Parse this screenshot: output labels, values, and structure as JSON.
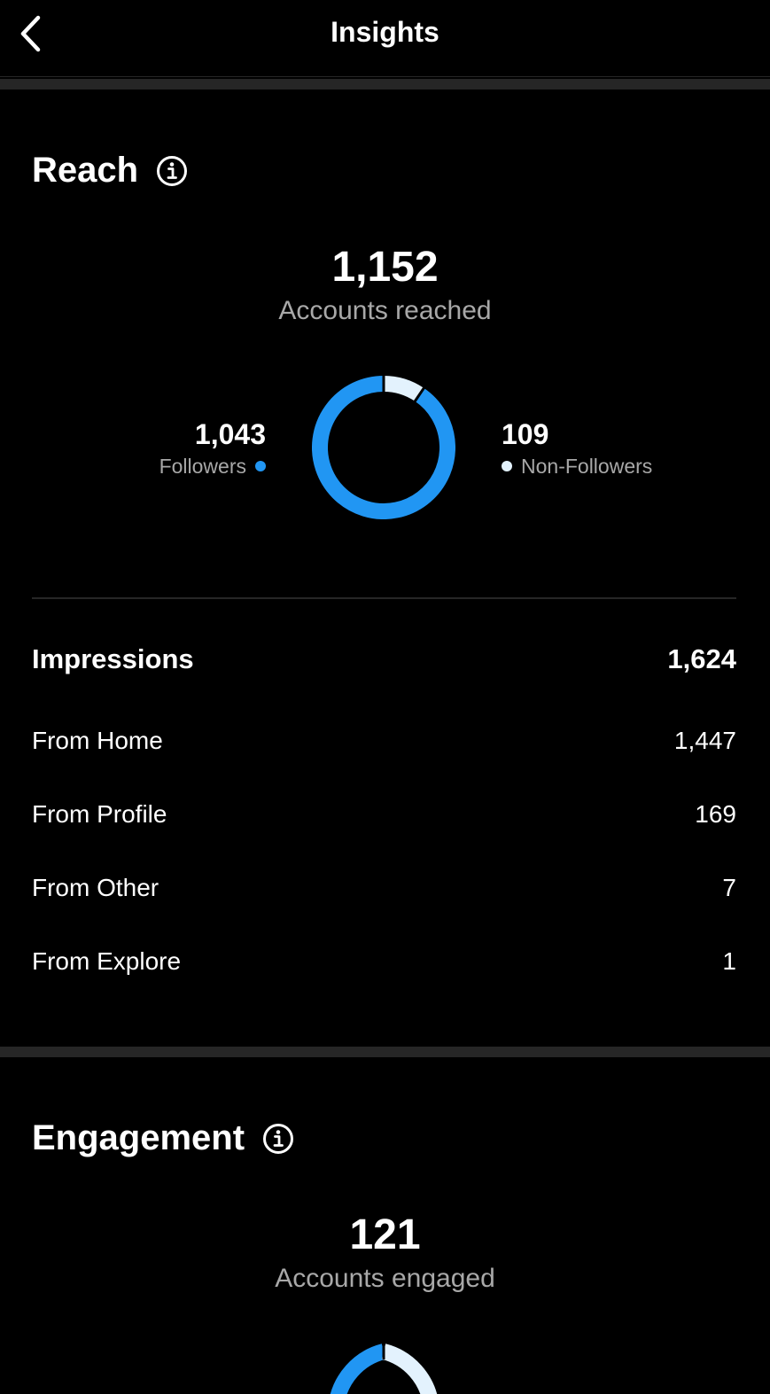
{
  "header": {
    "title": "Insights"
  },
  "reach": {
    "title": "Reach",
    "accounts_reached": "1,152",
    "accounts_reached_label": "Accounts reached",
    "followers_value": "1,043",
    "followers_label": "Followers",
    "non_followers_value": "109",
    "non_followers_label": "Non-Followers",
    "followers_color": "#2196f3",
    "non_followers_color": "#e3f2fd"
  },
  "chart_data": {
    "type": "pie",
    "categories": [
      "Followers",
      "Non-Followers"
    ],
    "values": [
      1043,
      109
    ],
    "colors": [
      "#2196f3",
      "#e3f2fd"
    ]
  },
  "impressions": {
    "label": "Impressions",
    "value": "1,624",
    "rows": [
      {
        "label": "From Home",
        "value": "1,447"
      },
      {
        "label": "From Profile",
        "value": "169"
      },
      {
        "label": "From Other",
        "value": "7"
      },
      {
        "label": "From Explore",
        "value": "1"
      }
    ]
  },
  "engagement": {
    "title": "Engagement",
    "accounts_engaged": "121",
    "accounts_engaged_label": "Accounts engaged"
  },
  "icons": {
    "back": "chevron-left-icon",
    "info": "info-circle-icon"
  }
}
